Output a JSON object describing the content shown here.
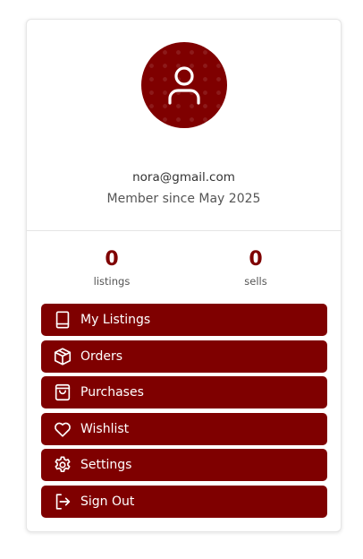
{
  "profile": {
    "email": "nora@gmail.com",
    "member_since": "Member since May 2025",
    "avatar_icon": "user-icon"
  },
  "stats": [
    {
      "value": "0",
      "label": "listings"
    },
    {
      "value": "0",
      "label": "sells"
    }
  ],
  "menu": [
    {
      "label": "My Listings",
      "icon": "book-icon"
    },
    {
      "label": "Orders",
      "icon": "box-icon"
    },
    {
      "label": "Purchases",
      "icon": "shopping-bag-icon"
    },
    {
      "label": "Wishlist",
      "icon": "heart-icon"
    },
    {
      "label": "Settings",
      "icon": "gear-icon"
    },
    {
      "label": "Sign Out",
      "icon": "sign-out-icon"
    }
  ],
  "colors": {
    "accent": "#7f0000",
    "text_muted": "#555555"
  }
}
